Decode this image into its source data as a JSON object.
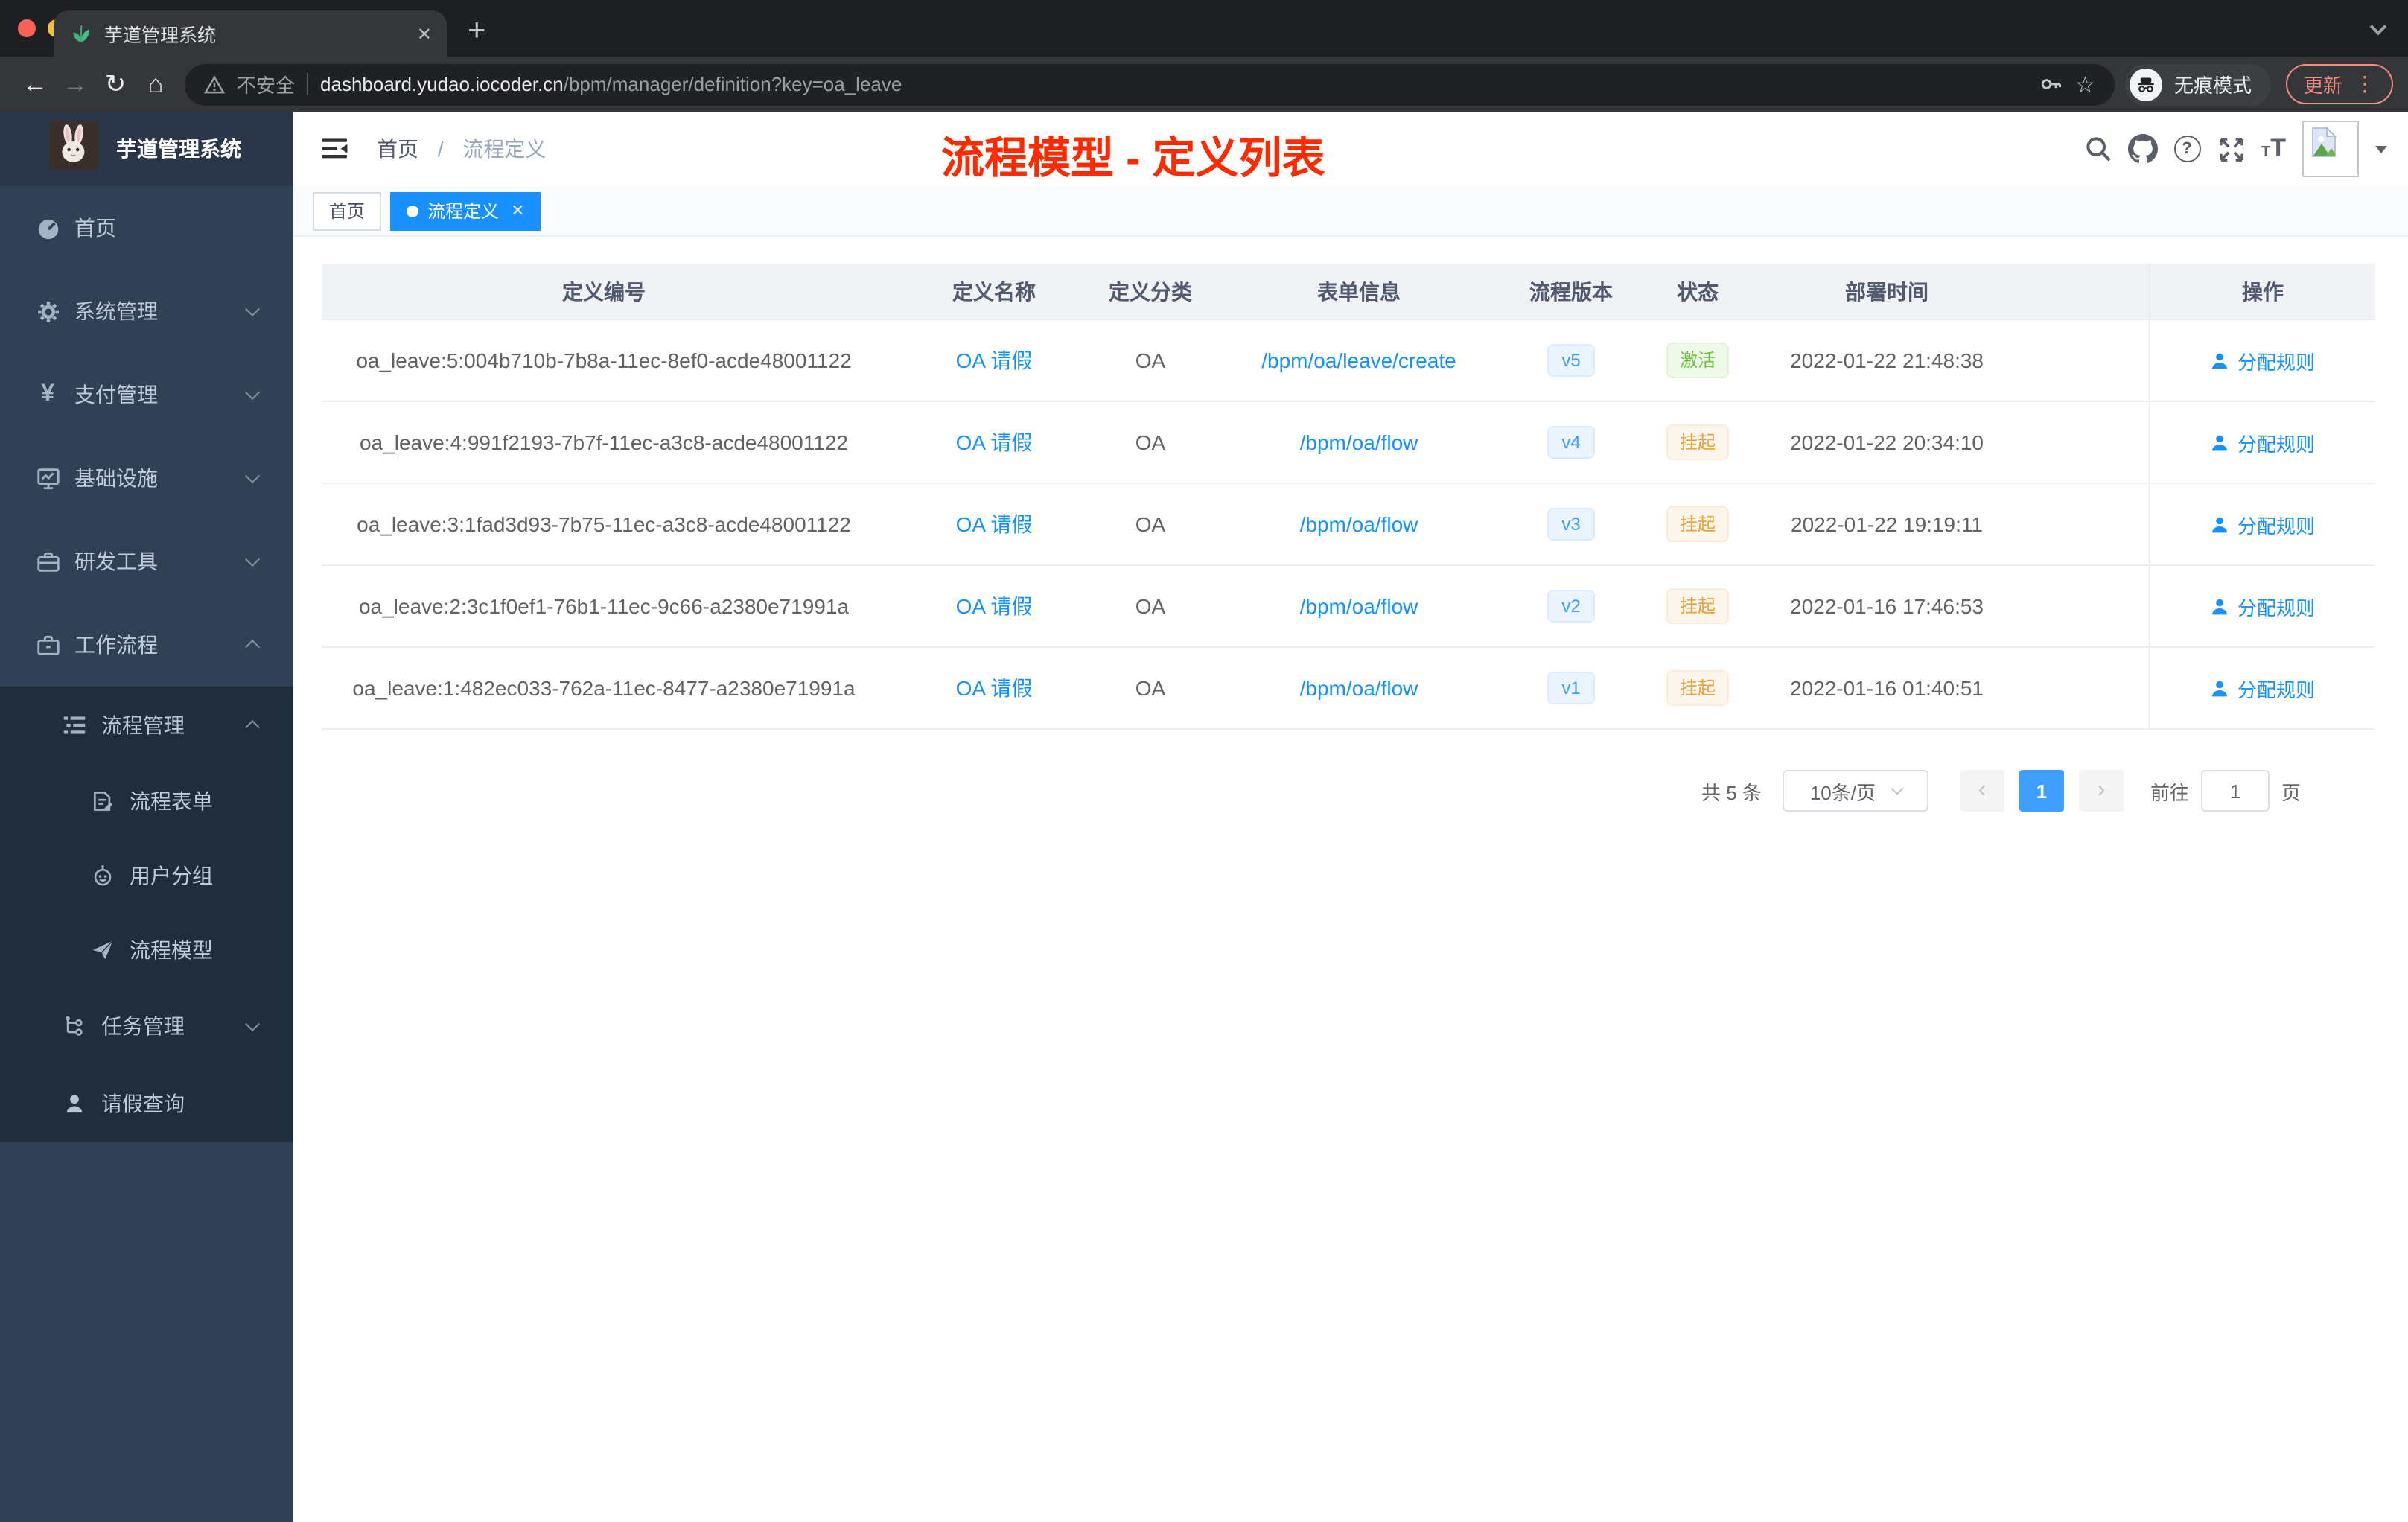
{
  "glyphs": {
    "back": "←",
    "forward": "→",
    "reload": "↻",
    "home": "⌂",
    "star": "☆",
    "kebab": "⋮",
    "close": "✕",
    "plus": "+",
    "prev": "‹",
    "next": "›",
    "question": "?",
    "yen": "¥",
    "t_small": "T",
    "t_large": "T"
  },
  "browser": {
    "tab_title": "芋道管理系统",
    "security_label": "不安全",
    "url_host": "dashboard.yudao.iocoder.cn",
    "url_path": "/bpm/manager/definition?key=oa_leave",
    "incognito_label": "无痕模式",
    "update_label": "更新"
  },
  "sidebar": {
    "title": "芋道管理系统",
    "items": [
      {
        "label": "首页",
        "icon": "dashboard-icon"
      },
      {
        "label": "系统管理",
        "icon": "gear-icon"
      },
      {
        "label": "支付管理",
        "icon": "yen-icon"
      },
      {
        "label": "基础设施",
        "icon": "monitor-icon"
      },
      {
        "label": "研发工具",
        "icon": "toolbox-icon"
      },
      {
        "label": "工作流程",
        "icon": "briefcase-icon"
      }
    ],
    "submenu": {
      "group": {
        "label": "流程管理",
        "icon": "tree-list-icon"
      },
      "children": [
        {
          "label": "流程表单",
          "icon": "form-icon"
        },
        {
          "label": "用户分组",
          "icon": "robot-icon"
        },
        {
          "label": "流程模型",
          "icon": "paper-plane-icon"
        }
      ],
      "tail": [
        {
          "label": "任务管理",
          "icon": "org-tree-icon"
        },
        {
          "label": "请假查询",
          "icon": "person-icon"
        }
      ]
    }
  },
  "header": {
    "breadcrumb": {
      "home": "首页",
      "separator": "/",
      "current": "流程定义"
    },
    "annotation": "流程模型 - 定义列表"
  },
  "tags": {
    "home": "首页",
    "active": "流程定义"
  },
  "table": {
    "columns": [
      "定义编号",
      "定义名称",
      "定义分类",
      "表单信息",
      "流程版本",
      "状态",
      "部署时间",
      "操作"
    ],
    "rows": [
      {
        "id": "oa_leave:5:004b710b-7b8a-11ec-8ef0-acde48001122",
        "name": "OA 请假",
        "category": "OA",
        "form": "/bpm/oa/leave/create",
        "version": "v5",
        "status": "激活",
        "status_type": "success",
        "deployed_at": "2022-01-22 21:48:38",
        "action": "分配规则"
      },
      {
        "id": "oa_leave:4:991f2193-7b7f-11ec-a3c8-acde48001122",
        "name": "OA 请假",
        "category": "OA",
        "form": "/bpm/oa/flow",
        "version": "v4",
        "status": "挂起",
        "status_type": "warning",
        "deployed_at": "2022-01-22 20:34:10",
        "action": "分配规则"
      },
      {
        "id": "oa_leave:3:1fad3d93-7b75-11ec-a3c8-acde48001122",
        "name": "OA 请假",
        "category": "OA",
        "form": "/bpm/oa/flow",
        "version": "v3",
        "status": "挂起",
        "status_type": "warning",
        "deployed_at": "2022-01-22 19:19:11",
        "action": "分配规则"
      },
      {
        "id": "oa_leave:2:3c1f0ef1-76b1-11ec-9c66-a2380e71991a",
        "name": "OA 请假",
        "category": "OA",
        "form": "/bpm/oa/flow",
        "version": "v2",
        "status": "挂起",
        "status_type": "warning",
        "deployed_at": "2022-01-16 17:46:53",
        "action": "分配规则"
      },
      {
        "id": "oa_leave:1:482ec033-762a-11ec-8477-a2380e71991a",
        "name": "OA 请假",
        "category": "OA",
        "form": "/bpm/oa/flow",
        "version": "v1",
        "status": "挂起",
        "status_type": "warning",
        "deployed_at": "2022-01-16 01:40:51",
        "action": "分配规则"
      }
    ]
  },
  "pagination": {
    "total": "共 5 条",
    "page_size": "10条/页",
    "current_page": "1",
    "goto_label": "前往",
    "goto_value": "1",
    "unit_label": "页"
  },
  "colors": {
    "accent": "#1890ff",
    "link": "#409eff",
    "success": "#67c23a",
    "warning": "#e6a23c",
    "annotation_red": "#ff2a00",
    "sidebar_bg": "#304156",
    "submenu_bg": "#1f2d3d"
  }
}
